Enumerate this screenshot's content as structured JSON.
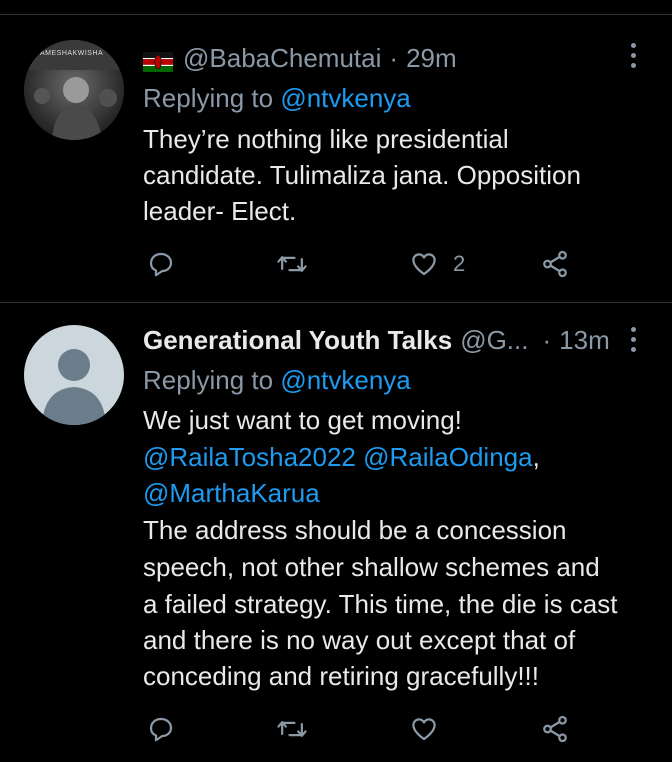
{
  "tweets": [
    {
      "flag": "🇰🇪",
      "display_name": "",
      "handle": "@BabaChemutai",
      "separator": "·",
      "time": "29m",
      "replying_prefix": "Replying to",
      "replying_to": "@ntvkenya",
      "lines": [
        "They’re nothing like presidential",
        "candidate. Tulimaliza jana. Opposition",
        "leader- Elect."
      ],
      "avatar_caption": "AMESHAKWISHA",
      "stats": {
        "reply": "",
        "retweet": "",
        "like": "2",
        "share": ""
      }
    },
    {
      "display_name": "Generational Youth Talks",
      "handle": "@G...",
      "separator": "·",
      "time": "13m",
      "replying_prefix": "Replying to",
      "replying_to": "@ntvkenya",
      "body_line1": "We just want to get moving!",
      "mention1": "@RailaTosha2022",
      "mention2": "@RailaOdinga",
      "mention_sep": ",",
      "mention3": "@MarthaKarua",
      "lines": [
        "The address should be a concession",
        "speech, not other shallow schemes and",
        "a failed strategy. This time, the die is cast",
        "and there is no way out except that of",
        "conceding and retiring gracefully!!!"
      ],
      "stats": {
        "reply": "",
        "retweet": "",
        "like": "",
        "share": ""
      }
    }
  ],
  "colors": {
    "background": "#000000",
    "text": "#e7e9ea",
    "muted": "#8b98a5",
    "link": "#1d9bf0",
    "divider": "#2f3336"
  },
  "icons": [
    "more-icon",
    "reply-icon",
    "retweet-icon",
    "like-icon",
    "share-icon",
    "kenya-flag-icon",
    "default-avatar-icon"
  ]
}
